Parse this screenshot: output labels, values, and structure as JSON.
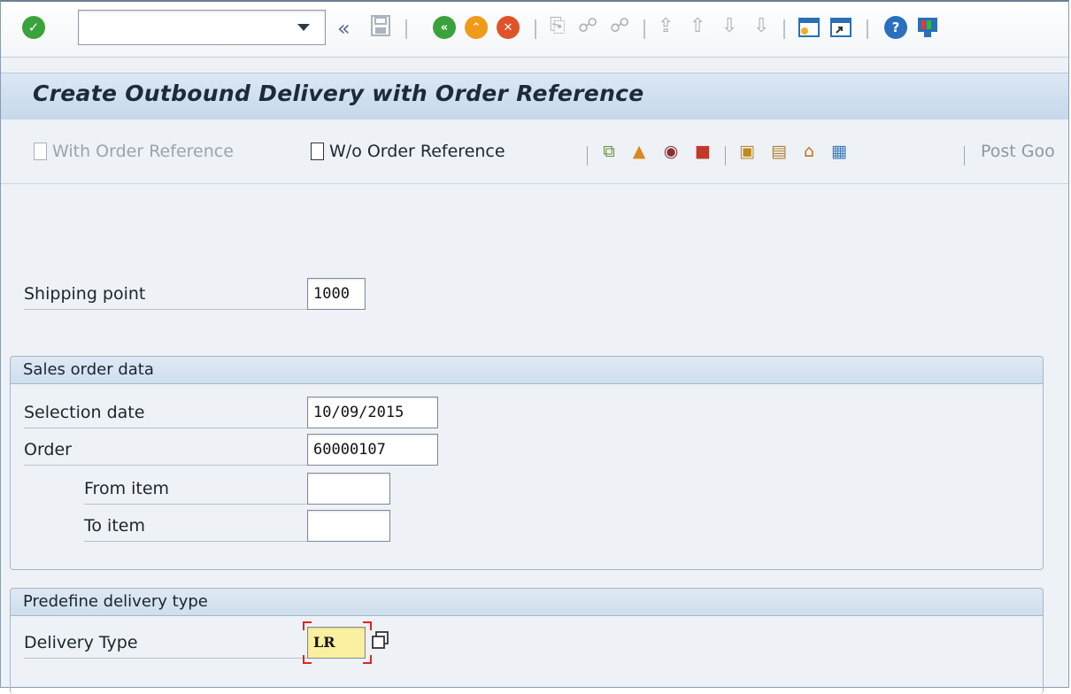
{
  "toolbar": {
    "command_value": "",
    "icons": [
      "enter-icon",
      "save-icon",
      "back-icon",
      "exit-icon",
      "cancel-icon",
      "print-icon",
      "find-icon",
      "find-next-icon",
      "first-page-icon",
      "previous-page-icon",
      "next-page-icon",
      "last-page-icon",
      "create-session-icon",
      "shortcut-icon",
      "help-icon",
      "customize-layout-icon"
    ],
    "colors": {
      "enter": "#3aa23a",
      "back": "#3aa23a",
      "exit": "#f09a1a",
      "cancel": "#e0532a",
      "help": "#2a6fc0"
    }
  },
  "page": {
    "title": "Create Outbound Delivery with Order Reference"
  },
  "app_toolbar": {
    "with_order_label": "With Order Reference",
    "wo_order_label": "W/o Order Reference",
    "post_goods_label": "Post Goo"
  },
  "form": {
    "shipping_point_label": "Shipping point",
    "shipping_point_value": "1000",
    "sales_order_group_title": "Sales order data",
    "selection_date_label": "Selection date",
    "selection_date_value": "10/09/2015",
    "order_label": "Order",
    "order_value": "60000107",
    "from_item_label": "From item",
    "from_item_value": "",
    "to_item_label": "To item",
    "to_item_value": "",
    "delivery_group_title": "Predefine delivery type",
    "delivery_type_label": "Delivery Type",
    "delivery_type_value": "LR"
  }
}
